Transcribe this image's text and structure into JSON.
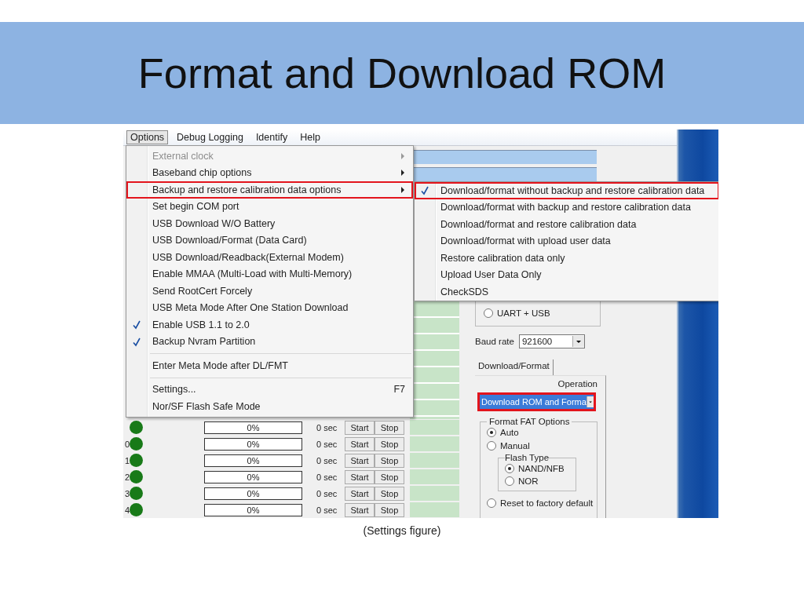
{
  "slide": {
    "title": "Format and Download ROM",
    "caption": "(Settings figure)"
  },
  "menubar": [
    {
      "label": "Options",
      "selected": true
    },
    {
      "label": "Debug Logging",
      "selected": false
    },
    {
      "label": "Identify",
      "selected": false
    },
    {
      "label": "Help",
      "selected": false
    }
  ],
  "options_menu": [
    {
      "kind": "item",
      "label": "External clock",
      "disabled": true,
      "checked": false,
      "submenu": true,
      "outlined": false
    },
    {
      "kind": "item",
      "label": "Baseband chip options",
      "disabled": false,
      "checked": false,
      "submenu": true,
      "outlined": false
    },
    {
      "kind": "item",
      "label": "Backup and restore calibration data options",
      "disabled": false,
      "checked": false,
      "submenu": true,
      "outlined": true
    },
    {
      "kind": "item",
      "label": "Set begin COM port",
      "disabled": false,
      "checked": false,
      "submenu": false,
      "outlined": false
    },
    {
      "kind": "item",
      "label": "USB Download W/O Battery",
      "disabled": false,
      "checked": false,
      "submenu": false,
      "outlined": false
    },
    {
      "kind": "item",
      "label": "USB Download/Format  (Data Card)",
      "disabled": false,
      "checked": false,
      "submenu": false,
      "outlined": false
    },
    {
      "kind": "item",
      "label": "USB Download/Readback(External Modem)",
      "disabled": false,
      "checked": false,
      "submenu": false,
      "outlined": false
    },
    {
      "kind": "item",
      "label": "Enable MMAA (Multi-Load with Multi-Memory)",
      "disabled": false,
      "checked": false,
      "submenu": false,
      "outlined": false
    },
    {
      "kind": "item",
      "label": "Send RootCert Forcely",
      "disabled": false,
      "checked": false,
      "submenu": false,
      "outlined": false
    },
    {
      "kind": "item",
      "label": "USB Meta Mode After One Station Download",
      "disabled": false,
      "checked": false,
      "submenu": false,
      "outlined": false
    },
    {
      "kind": "item",
      "label": "Enable USB 1.1 to 2.0",
      "disabled": false,
      "checked": true,
      "submenu": false,
      "outlined": false
    },
    {
      "kind": "item",
      "label": "Backup Nvram Partition",
      "disabled": false,
      "checked": true,
      "submenu": false,
      "outlined": false
    },
    {
      "kind": "separator"
    },
    {
      "kind": "item",
      "label": "Enter Meta Mode after DL/FMT",
      "disabled": false,
      "checked": false,
      "submenu": false,
      "outlined": false
    },
    {
      "kind": "separator"
    },
    {
      "kind": "item",
      "label": "Settings...",
      "shortcut": "F7",
      "disabled": false,
      "checked": false,
      "submenu": false,
      "outlined": false
    },
    {
      "kind": "item",
      "label": "Nor/SF Flash Safe Mode",
      "disabled": false,
      "checked": false,
      "submenu": false,
      "outlined": false
    }
  ],
  "calibration_submenu": [
    {
      "label": "Download/format without backup and restore calibration data",
      "checked": true,
      "outlined": true
    },
    {
      "label": "Download/format with backup and restore calibration data",
      "checked": false,
      "outlined": false
    },
    {
      "label": "Download/format and restore calibration data",
      "checked": false,
      "outlined": false
    },
    {
      "label": "Download/format with upload user data",
      "checked": false,
      "outlined": false
    },
    {
      "label": "Restore calibration data only",
      "checked": false,
      "outlined": false
    },
    {
      "label": "Upload User Data Only",
      "checked": false,
      "outlined": false
    },
    {
      "label": "CheckSDS",
      "checked": false,
      "outlined": false
    }
  ],
  "ports": [
    {
      "progress": "0%",
      "level": 0,
      "time": "0 sec",
      "start": "Start",
      "stop": "Stop"
    },
    {
      "index": "0",
      "progress": "0%",
      "level": 0,
      "time": "0 sec",
      "start": "Start",
      "stop": "Stop"
    },
    {
      "index": "1",
      "progress": "0%",
      "level": 0,
      "time": "0 sec",
      "start": "Start",
      "stop": "Stop"
    },
    {
      "index": "2",
      "progress": "0%",
      "level": 0,
      "time": "0 sec",
      "start": "Start",
      "stop": "Stop"
    },
    {
      "index": "3",
      "progress": "0%",
      "level": 0,
      "time": "0 sec",
      "start": "Start",
      "stop": "Stop"
    },
    {
      "index": "4",
      "progress": "0%",
      "level": 0,
      "time": "0 sec",
      "start": "Start",
      "stop": "Stop"
    }
  ],
  "connection": {
    "label": "UART + USB",
    "selected": false
  },
  "baud_rate": {
    "label": "Baud rate",
    "value": "921600"
  },
  "tabs": [
    {
      "label": "Download/Format",
      "selected": true
    }
  ],
  "operation": {
    "label": "Operation",
    "value": "Download ROM and Forma",
    "outlined": true
  },
  "format_fat": {
    "title": "Format FAT Options",
    "options": [
      {
        "label": "Auto",
        "selected": true
      },
      {
        "label": "Manual",
        "selected": false
      }
    ],
    "flash_type": {
      "title": "Flash  Type",
      "options": [
        {
          "label": "NAND/NFB",
          "selected": true
        },
        {
          "label": "NOR",
          "selected": false
        }
      ]
    },
    "reset": {
      "label": "Reset to factory default",
      "selected": false
    }
  }
}
